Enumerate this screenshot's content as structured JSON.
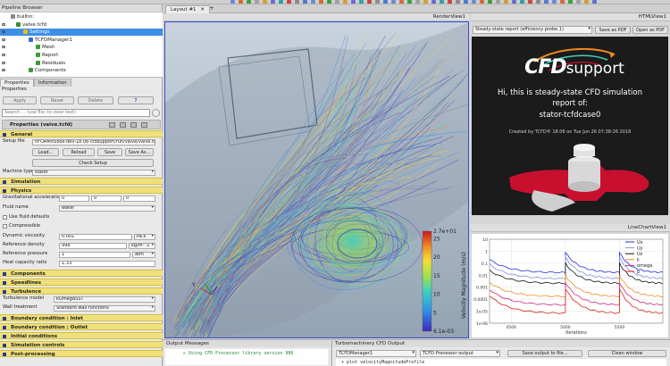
{
  "pipeline": {
    "title": "Pipeline Browser",
    "items": [
      {
        "label": "builtin:",
        "indent": 4,
        "sel": false
      },
      {
        "label": "valve.tcfd",
        "indent": 10,
        "sel": false
      },
      {
        "label": "Settings",
        "indent": 18,
        "sel": true
      },
      {
        "label": "TCFDManager1",
        "indent": 24,
        "sel": false
      },
      {
        "label": "Mesh",
        "indent": 32,
        "sel": false
      },
      {
        "label": "Report",
        "indent": 32,
        "sel": false
      },
      {
        "label": "Residuals",
        "indent": 32,
        "sel": false
      },
      {
        "label": "Components",
        "indent": 24,
        "sel": false
      }
    ]
  },
  "tabs": [
    "Properties",
    "Information"
  ],
  "properties": {
    "title": "Properties",
    "apply": "Apply",
    "reset": "Reset",
    "delete": "Delete",
    "help": "?",
    "search_placeholder": "Search ... (use Esc to clear text)",
    "object_title": "Properties (valve.tcfd)",
    "general": "General",
    "setup_file_label": "Setup file",
    "setup_file_value": "nFOAM/tubos-dev-18.06-cfdsupport/run/valve/valve.tcfd",
    "load": "Load...",
    "reload": "Reload",
    "save": "Save",
    "save_as": "Save As...",
    "check_setup": "Check Setup",
    "machine_type_label": "Machine type",
    "machine_type_value": "stator",
    "simulation": "Simulation",
    "physics": "Physics",
    "grav_label": "Gravitational acceleration",
    "grav_values": [
      "0",
      "0",
      "0"
    ],
    "fluid_label": "Fluid name",
    "fluid_value": "water",
    "use_fluid_defaults": "Use fluid defaults",
    "compressible": "Compressible",
    "dyn_visc_label": "Dynamic viscosity",
    "dyn_visc_value": "0.001",
    "dyn_visc_unit": "Pa.s",
    "ref_density_label": "Reference density",
    "ref_density_value": "998",
    "ref_density_unit": "kg/m^3",
    "ref_pressure_label": "Reference pressure",
    "ref_pressure_value": "1",
    "ref_pressure_unit": "atm",
    "heat_cap_label": "Heat capacity ratio",
    "heat_cap_value": "1.33",
    "components": "Components",
    "speedlines": "Speedlines",
    "turbulence": "Turbulence",
    "turb_model_label": "Turbulence model",
    "turb_model_value": "kOmegaSST",
    "wall_treat_label": "Wall treatment",
    "wall_treat_value": "Standard wall functions",
    "bc_inlet": "Boundary condition : Inlet",
    "bc_outlet": "Boundary condition : Outlet",
    "init_cond": "Initial conditions",
    "sim_controls": "Simulation controls",
    "post_proc": "Post-processing"
  },
  "layout_tab": "Layout #1",
  "render": {
    "title": "RenderView1",
    "colorbar_title": "Velocity Magnitude (m/s)",
    "colorbar_max": "2.7e+01",
    "colorbar_min": "6.1e-03",
    "colorbar_ticks": [
      25,
      20,
      15,
      10,
      5
    ],
    "axis_y": "Y"
  },
  "html_view": {
    "title": "HTMLView1",
    "report_select": "Steady-state report (efficiency probe 1)",
    "save_pdf": "Save as PDF",
    "open_pdf": "Open as PDF",
    "logo_main": "CFD",
    "logo_sub": "support",
    "hi_line1": "Hi, this is steady-state CFD simulation",
    "hi_line2": "report of:",
    "case_name": "stator-tcfdcase0",
    "created": "Created by TCFD® 18.06 on Tue Jun 26 07:38:26 2018",
    "accent": "#c8102e"
  },
  "chart_view": {
    "title": "LineChartView1"
  },
  "chart_data": {
    "type": "line",
    "xlabel": "Iterations",
    "ylabel": "",
    "xlim": [
      4300,
      5900
    ],
    "ylim_log": [
      -6,
      1
    ],
    "x_ticks": [
      4500,
      5000,
      5500
    ],
    "y_tick_labels": [
      "10",
      "1",
      "0.1",
      "0.01",
      "0.001",
      "0.0001",
      "1e-05",
      "1e-06"
    ],
    "log_y": true,
    "legend_position": "top-right",
    "restart_x": [
      4300,
      5000,
      5500,
      5900
    ],
    "series": [
      {
        "name": "Ux",
        "color": "#1f2fd6",
        "start": -0.1,
        "end": -1.8
      },
      {
        "name": "Uy",
        "color": "#7e8ee0",
        "start": -0.5,
        "end": -2.3
      },
      {
        "name": "Uz",
        "color": "#111111",
        "start": -1.0,
        "end": -2.7
      },
      {
        "name": "k",
        "color": "#f08a2a",
        "start": -2.0,
        "end": -3.8
      },
      {
        "name": "omega",
        "color": "#cc2a7a",
        "start": -2.6,
        "end": -4.5
      },
      {
        "name": "p",
        "color": "#d8241a",
        "start": -3.1,
        "end": -5.2
      }
    ]
  },
  "output_messages": {
    "title": "Output Messages",
    "line": "Using CFD Processor library version 986"
  },
  "turbo": {
    "title": "Turbomachinery CFD Output",
    "manager": "TCFDManager1",
    "output": "TCFD Processor output",
    "save_output": "Save output to file...",
    "clean": "Clean window",
    "log_line": "+ plot velocityMagnitudeProfile"
  }
}
